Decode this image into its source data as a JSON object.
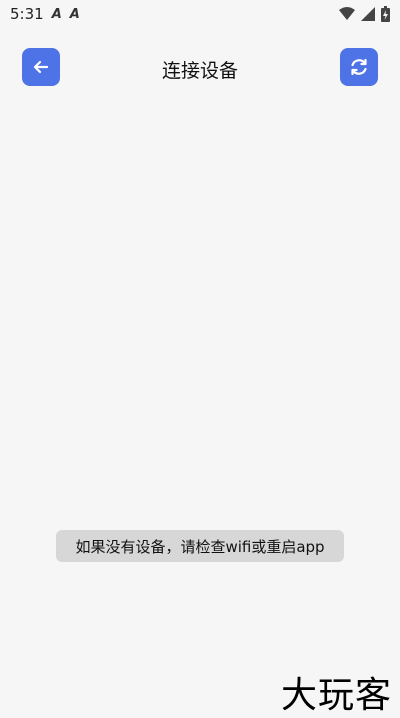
{
  "status_bar": {
    "time": "5:31",
    "notification_icon_1": "A",
    "notification_icon_2": "A",
    "icons": [
      "wifi-icon",
      "signal-icon",
      "battery-icon"
    ]
  },
  "header": {
    "title": "连接设备",
    "back_icon": "arrow-left-icon",
    "refresh_icon": "refresh-icon"
  },
  "toast": {
    "message": "如果没有设备，请检查wifi或重启app"
  },
  "watermark": {
    "text": "大玩客"
  },
  "colors": {
    "accent": "#4e73e6",
    "background": "#f6f6f6",
    "toast_bg": "#d7d7d7"
  }
}
